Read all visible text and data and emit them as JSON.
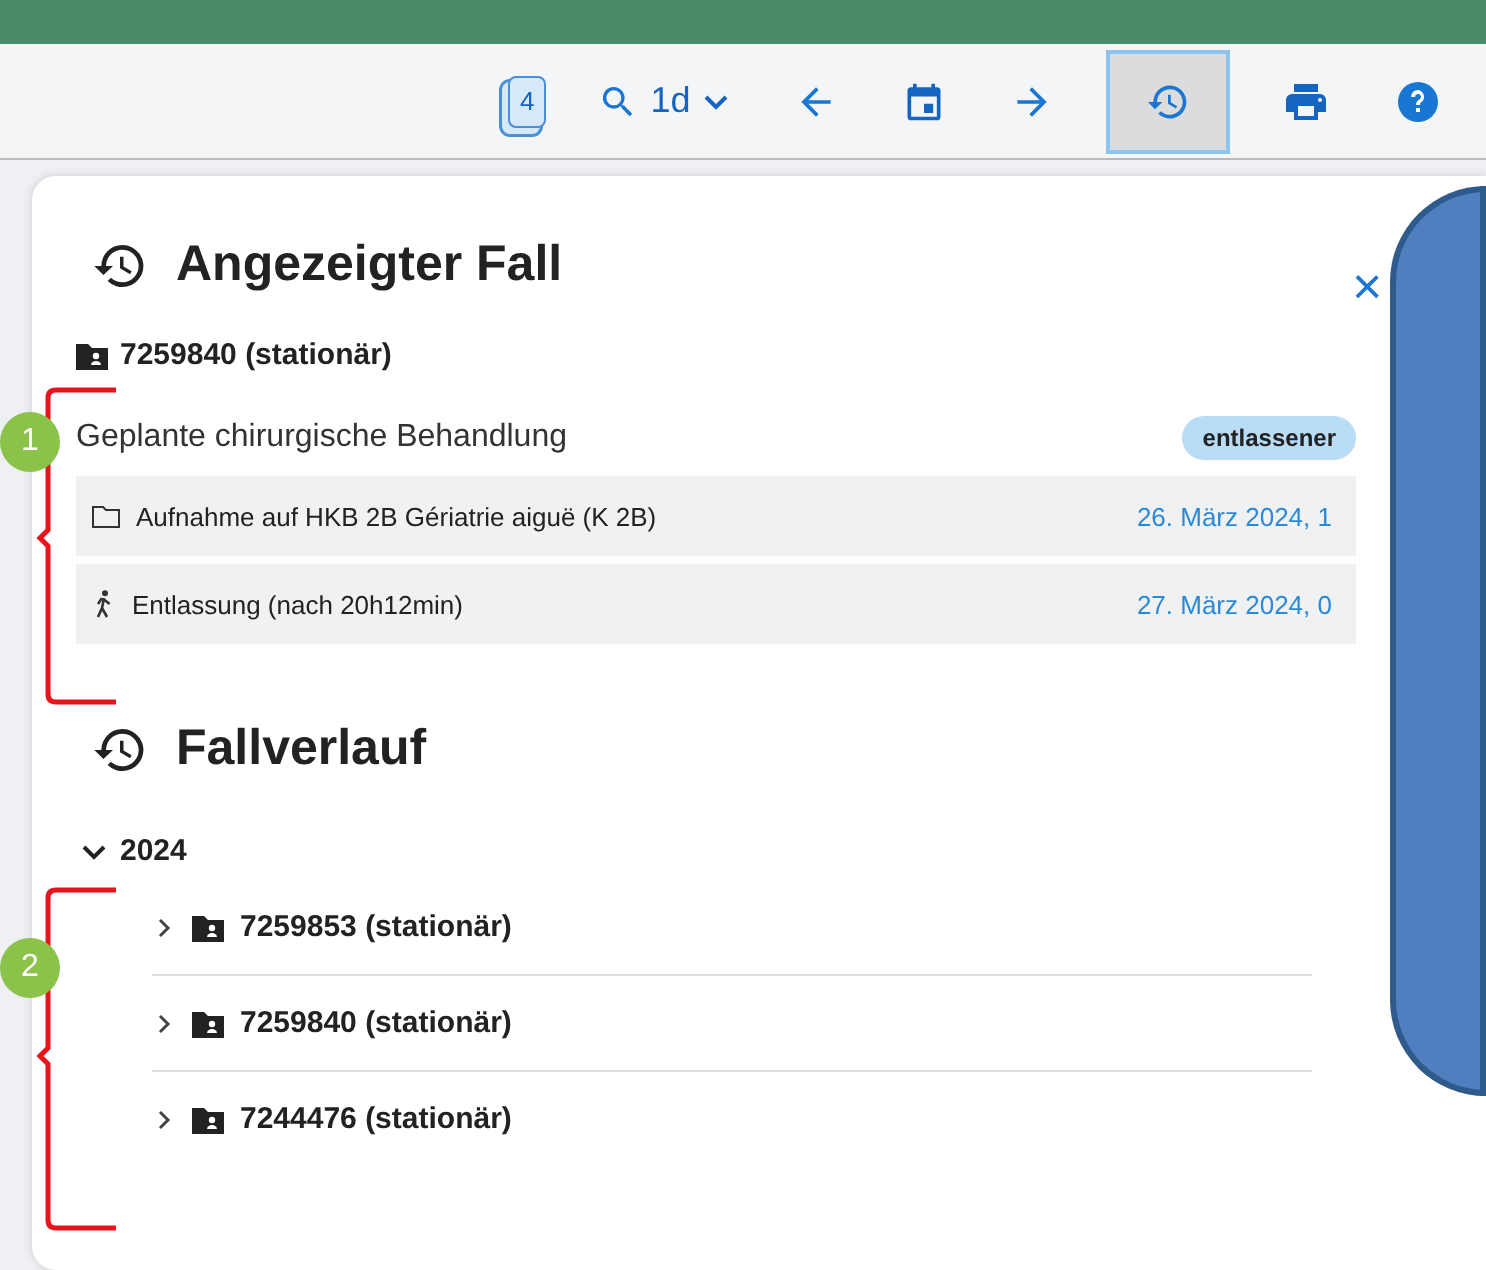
{
  "toolbar": {
    "items": [
      {
        "kind": "badge",
        "label": "4",
        "selected": false
      },
      {
        "kind": "search",
        "label": "1d",
        "selected": false
      },
      {
        "kind": "arrow-left",
        "selected": false
      },
      {
        "kind": "calendar",
        "selected": false
      },
      {
        "kind": "arrow-right",
        "selected": false
      },
      {
        "kind": "history",
        "selected": true
      },
      {
        "kind": "print",
        "selected": false
      },
      {
        "kind": "help",
        "selected": false
      }
    ]
  },
  "current_case": {
    "title": "Angezeigter Fall",
    "close": "×",
    "case": "7259840 (stationär)",
    "treatment": "Geplante chirurgische Behandlung",
    "status": "entlassener",
    "events": [
      {
        "kind": "admission",
        "text": "Aufnahme auf HKB 2B Gériatrie aiguë (K 2B)",
        "date": "26. März 2024, 1"
      },
      {
        "kind": "discharge",
        "text": "Entlassung (nach 20h12min)",
        "date": "27. März 2024, 0"
      }
    ]
  },
  "history": {
    "title": "Fallverlauf",
    "tree": [
      {
        "label": "2024",
        "expanded": true,
        "children": [
          {
            "label": "7259853 (stationär)",
            "expanded": false
          },
          {
            "label": "7259840 (stationär)",
            "expanded": false
          },
          {
            "label": "7244476 (stationär)",
            "expanded": false
          }
        ]
      }
    ]
  },
  "annotations": [
    {
      "number": "1"
    },
    {
      "number": "2"
    }
  ]
}
